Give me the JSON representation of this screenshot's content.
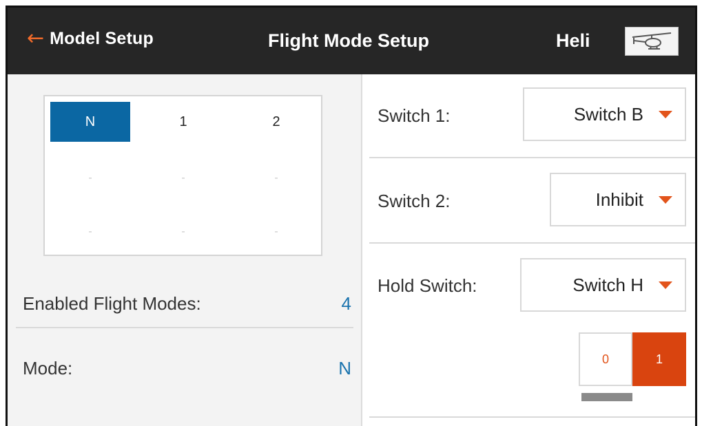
{
  "header": {
    "back_label": "Model Setup",
    "title": "Flight Mode Setup",
    "model_name": "Heli",
    "model_icon": "helicopter-icon",
    "accent_color": "#f06a2a"
  },
  "mode_grid": {
    "columns": [
      "N",
      "1",
      "2"
    ],
    "active": "N",
    "empty_rows": [
      [
        "-",
        "-",
        "-"
      ],
      [
        "-",
        "-",
        "-"
      ]
    ]
  },
  "left_panel": {
    "enabled_label": "Enabled Flight Modes:",
    "enabled_value": "4",
    "mode_label": "Mode:",
    "mode_value": "N"
  },
  "switches": {
    "switch1_label": "Switch 1:",
    "switch1_value": "Switch B",
    "switch2_label": "Switch 2:",
    "switch2_value": "Inhibit",
    "hold_label": "Hold Switch:",
    "hold_value": "Switch H"
  },
  "hold_toggle": {
    "positions": [
      "0",
      "1"
    ],
    "active": "1"
  },
  "colors": {
    "header_bg": "#262626",
    "active_cell": "#0b67a3",
    "value_blue": "#1a73ae",
    "dropdown_caret": "#e2541b",
    "toggle_active": "#d9440f"
  }
}
